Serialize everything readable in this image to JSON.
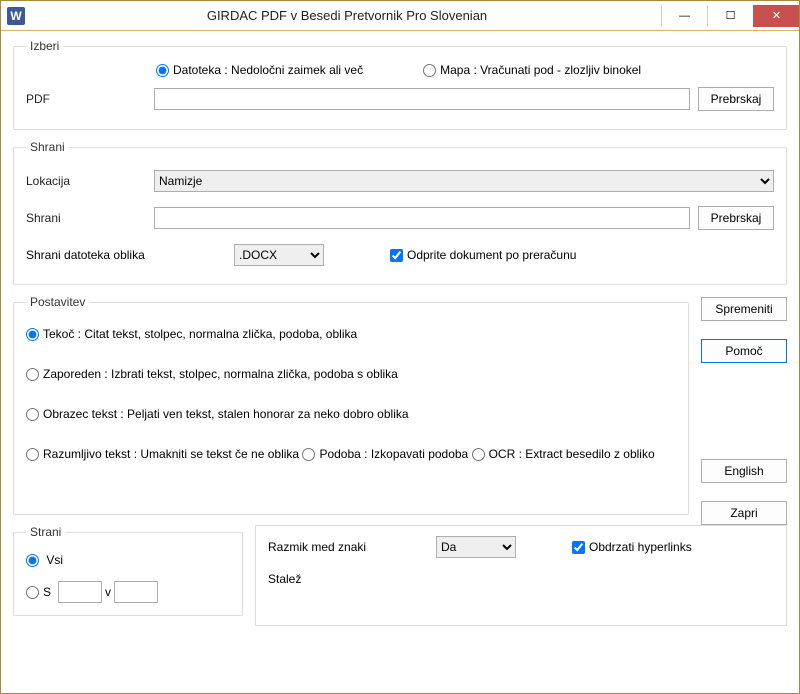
{
  "window": {
    "title": "GIRDAC PDF v Besedi Pretvornik Pro Slovenian",
    "icon_letter": "W"
  },
  "izberi": {
    "legend": "Izberi",
    "radio_datoteka": "Datoteka :  Nedoločni zaimek ali več",
    "radio_mapa": "Mapa :  Vračunati pod - zlozljiv binokel",
    "pdf_label": "PDF",
    "pdf_value": "",
    "browse": "Prebrskaj"
  },
  "shrani": {
    "legend": "Shrani",
    "lokacija_label": "Lokacija",
    "lokacija_selected": "Namizje",
    "shrani_label": "Shrani",
    "shrani_value": "",
    "browse": "Prebrskaj",
    "format_label": "Shrani datoteka oblika",
    "format_selected": ".DOCX",
    "open_after": "Odprite dokument po preračunu"
  },
  "postavitev": {
    "legend": "Postavitev",
    "opts": [
      "Tekoč :  Citat tekst, stolpec, normalna zlička, podoba, oblika",
      "Zaporeden :  Izbrati tekst, stolpec, normalna zlička, podoba s oblika",
      "Obrazec tekst :  Peljati ven tekst, stalen honorar za neko dobro oblika",
      "Razumljivo tekst :  Umakniti se tekst če ne oblika",
      "Podoba :  Izkopavati podoba",
      "OCR :  Extract besedilo z obliko"
    ]
  },
  "sidebtns": {
    "spremeniti": "Spremeniti",
    "pomoc": "Pomoč",
    "english": "English",
    "zapri": "Zapri"
  },
  "strani": {
    "legend": "Strani",
    "vsi": "Vsi",
    "s": "S",
    "v": "v",
    "from": "",
    "to": ""
  },
  "bottom": {
    "razmik_label": "Razmik med znaki",
    "razmik_selected": "Da",
    "hyperlinks": "Obdrzati hyperlinks",
    "stalez_label": "Stalež"
  }
}
